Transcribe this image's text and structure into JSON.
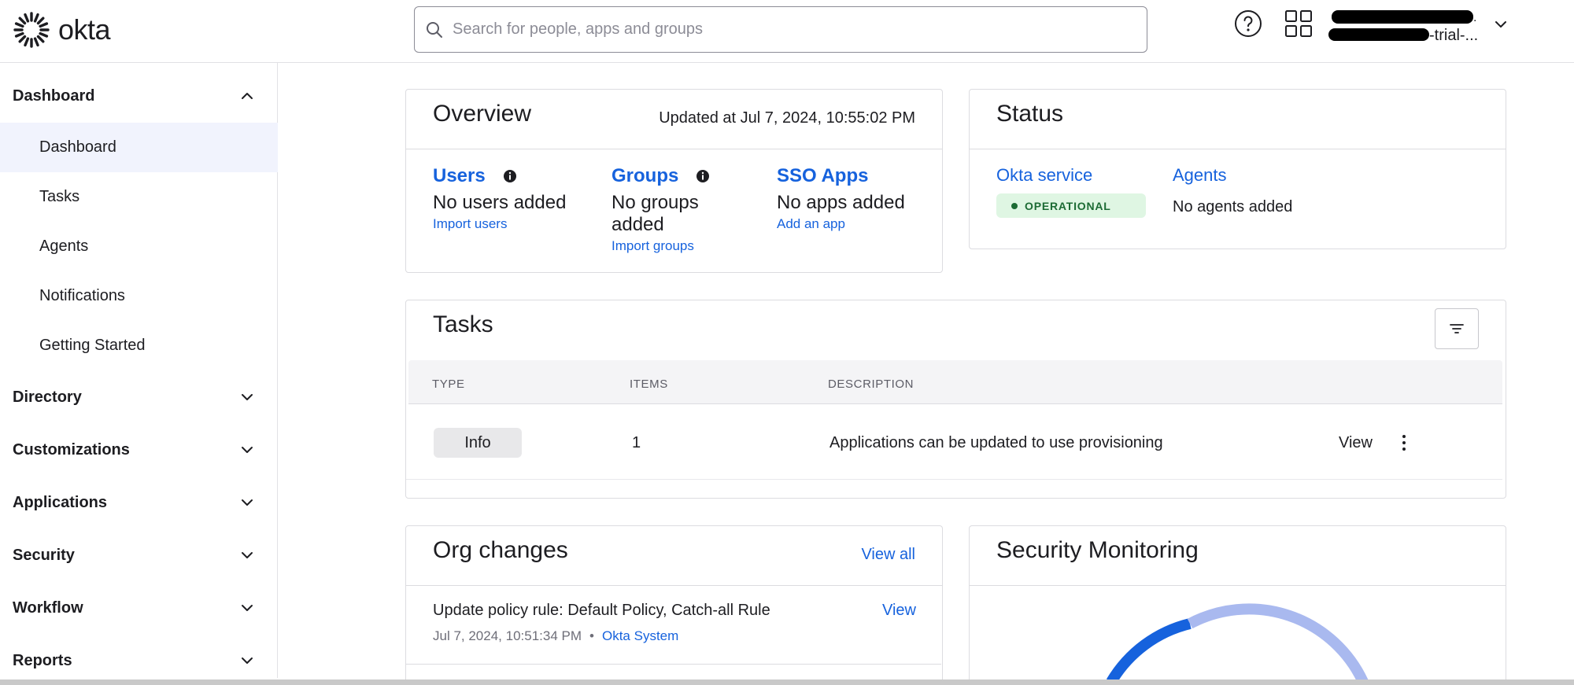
{
  "brand": {
    "name": "okta"
  },
  "search": {
    "placeholder": "Search for people, apps and groups"
  },
  "account": {
    "org_suffix": "-trial-...",
    "dot": "."
  },
  "sidebar": {
    "sections": [
      {
        "label": "Dashboard",
        "expanded": true,
        "items": [
          "Dashboard",
          "Tasks",
          "Agents",
          "Notifications",
          "Getting Started"
        ]
      },
      {
        "label": "Directory"
      },
      {
        "label": "Customizations"
      },
      {
        "label": "Applications"
      },
      {
        "label": "Security"
      },
      {
        "label": "Workflow"
      },
      {
        "label": "Reports"
      }
    ]
  },
  "overview": {
    "title": "Overview",
    "updated": "Updated at Jul 7, 2024, 10:55:02 PM",
    "users": {
      "label": "Users",
      "text": "No users added",
      "link": "Import users"
    },
    "groups": {
      "label": "Groups",
      "text_line1": "No groups",
      "text_line2": "added",
      "link": "Import groups"
    },
    "sso": {
      "label": "SSO Apps",
      "text": "No apps added",
      "link": "Add an app"
    }
  },
  "status": {
    "title": "Status",
    "okta_service": "Okta service",
    "operational": "OPERATIONAL",
    "agents": "Agents",
    "agents_text": "No agents added"
  },
  "tasks": {
    "title": "Tasks",
    "columns": [
      "TYPE",
      "ITEMS",
      "DESCRIPTION"
    ],
    "rows": [
      {
        "type": "Info",
        "items": "1",
        "description": "Applications can be updated to use provisioning",
        "action": "View"
      }
    ]
  },
  "org_changes": {
    "title": "Org changes",
    "view_all": "View all",
    "entries": [
      {
        "text": "Update policy rule: Default Policy, Catch-all Rule",
        "action": "View",
        "time": "Jul 7, 2024, 10:51:34 PM",
        "separator": "•",
        "actor": "Okta System"
      }
    ]
  },
  "security_monitoring": {
    "title": "Security Monitoring"
  },
  "colors": {
    "link": "#1662dd",
    "operational_bg": "#dff6e3",
    "operational_text": "#1c6b34",
    "gauge_dark": "#1662dd",
    "gauge_light": "#a9b9ef"
  }
}
